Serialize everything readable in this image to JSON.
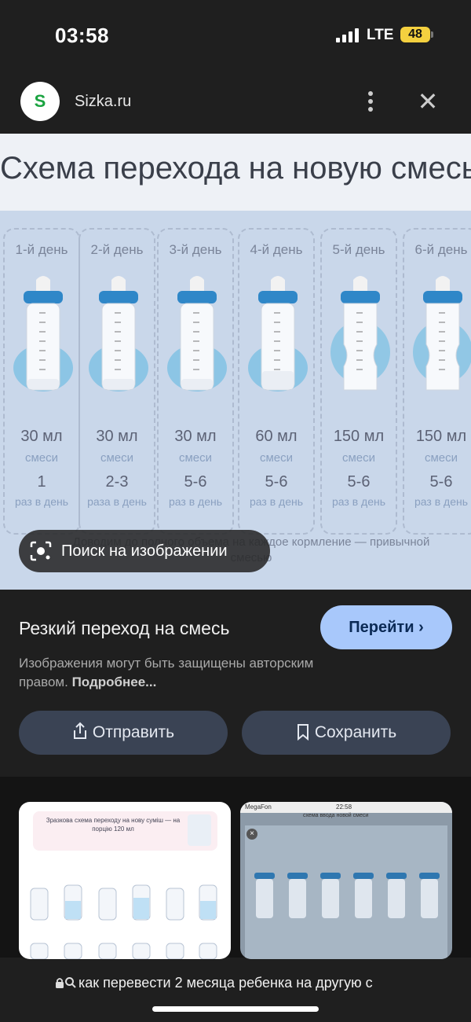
{
  "status_bar": {
    "time": "03:58",
    "network": "LTE",
    "battery": "48"
  },
  "site": {
    "logo_letter": "S",
    "name": "Sizka.ru"
  },
  "image": {
    "title": "Схема перехода на новую смесь",
    "columns": [
      {
        "day": "1-й день",
        "amount": "30 мл",
        "unit": "смеси",
        "times": "1",
        "per_day": "раз в день"
      },
      {
        "day": "2-й день",
        "amount": "30 мл",
        "unit": "смеси",
        "times": "2-3",
        "per_day": "раза в день"
      },
      {
        "day": "3-й день",
        "amount": "30 мл",
        "unit": "смеси",
        "times": "5-6",
        "per_day": "раз в день"
      },
      {
        "day": "4-й день",
        "amount": "60 мл",
        "unit": "смеси",
        "times": "5-6",
        "per_day": "раз в день"
      },
      {
        "day": "5-й день",
        "amount": "150 мл",
        "unit": "смеси",
        "times": "5-6",
        "per_day": "раз в день"
      },
      {
        "day": "6-й день",
        "amount": "150 мл",
        "unit": "смеси",
        "times": "5-6",
        "per_day": "раз в день"
      }
    ],
    "footnote": "Доводим до полного объема на каждое кормление — привычной смесью",
    "lens_label": "Поиск на изображении"
  },
  "result": {
    "title": "Резкий переход на смесь",
    "goto_label": "Перейти",
    "copyright_text": "Изображения могут быть защищены авторским правом.",
    "more_label": "Подробнее...",
    "share_label": "Отправить",
    "save_label": "Сохранить"
  },
  "related": {
    "thumb1_title": "Зразкова схема переходу на нову суміш — на порцію 120 мл",
    "thumb2_carrier": "MegaFon",
    "thumb2_time": "22:58",
    "thumb2_url": "схема ввода новой смеси"
  },
  "bottom": {
    "query": "как перевести 2 месяца ребенка на другую с"
  }
}
